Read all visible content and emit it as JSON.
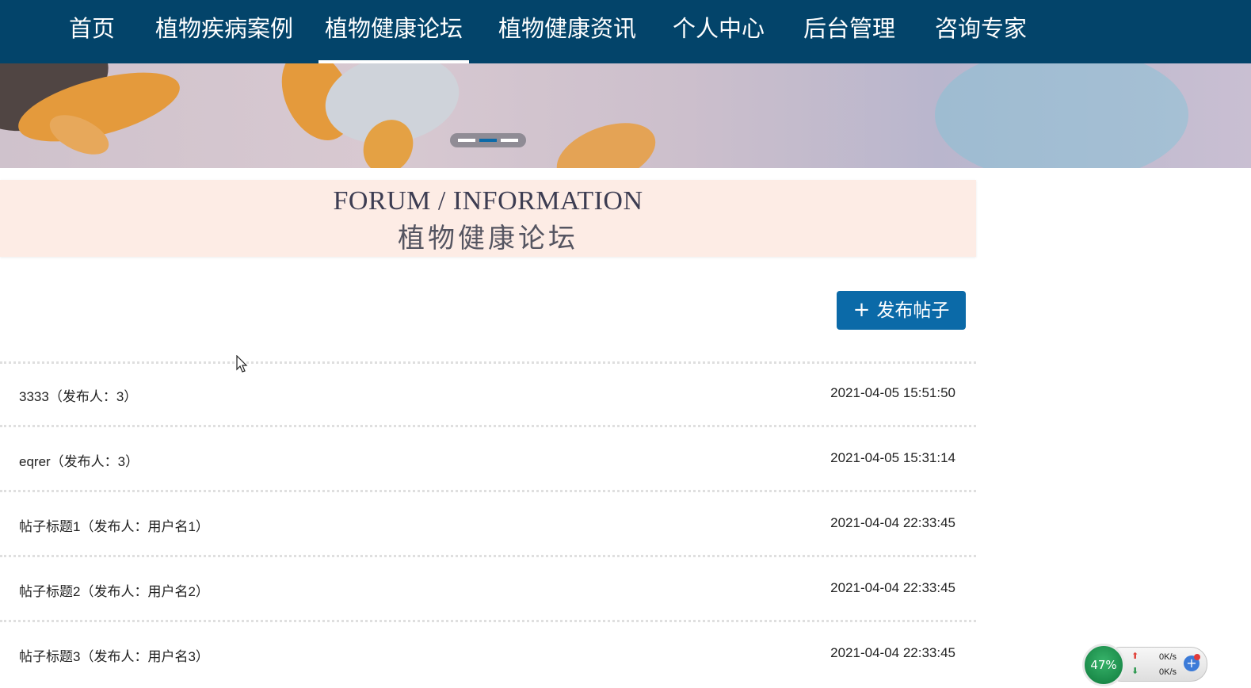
{
  "nav": {
    "items": [
      {
        "label": "首页"
      },
      {
        "label": "植物疾病案例"
      },
      {
        "label": "植物健康论坛",
        "active": true
      },
      {
        "label": "植物健康资讯"
      },
      {
        "label": "个人中心"
      },
      {
        "label": "后台管理"
      },
      {
        "label": "咨询专家"
      }
    ]
  },
  "banner": {
    "carousel_dots": 3,
    "active_dot": 2
  },
  "section": {
    "title_en": "FORUM / INFORMATION",
    "title_cn": "植物健康论坛"
  },
  "actions": {
    "post_icon": "plus-icon",
    "post_label": "发布帖子",
    "post_color": "#0b6aa8"
  },
  "posts": [
    {
      "title": "3333（发布人：3）",
      "time": "2021-04-05 15:51:50"
    },
    {
      "title": "eqrer（发布人：3）",
      "time": "2021-04-05 15:31:14"
    },
    {
      "title": "帖子标题1（发布人：用户名1）",
      "time": "2021-04-04 22:33:45"
    },
    {
      "title": "帖子标题2（发布人：用户名2）",
      "time": "2021-04-04 22:33:45"
    },
    {
      "title": "帖子标题3（发布人：用户名3）",
      "time": "2021-04-04 22:33:45"
    }
  ],
  "widget": {
    "percent": "47%",
    "upload": "0K/s",
    "download": "0K/s"
  },
  "colors": {
    "nav_bg": "#03446a",
    "section_bg": "#fdece5"
  }
}
